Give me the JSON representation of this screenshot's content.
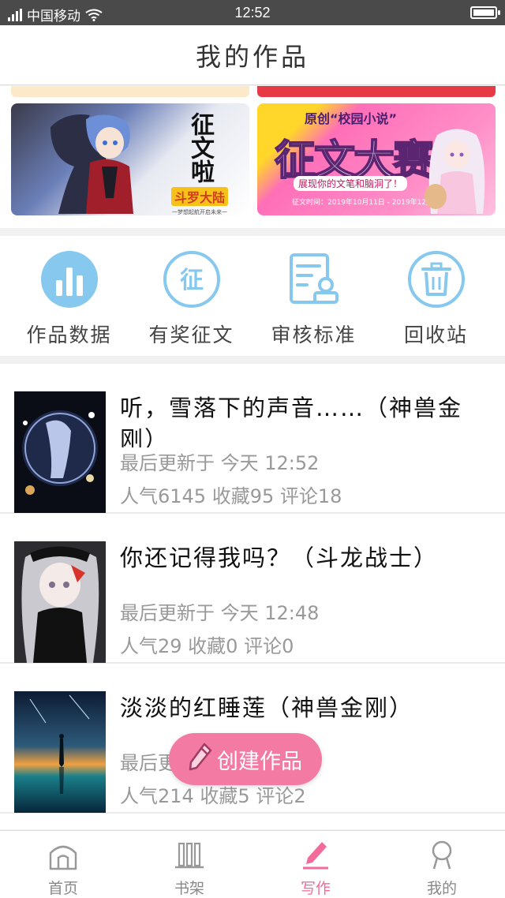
{
  "status_bar": {
    "carrier": "中国移动",
    "time": "12:52"
  },
  "header": {
    "title": "我的作品"
  },
  "banners": [
    {
      "title": "征文啦",
      "subtitle": "斗罗大陆",
      "caption": "一梦想起航开启未来一"
    },
    {
      "heading": "原创“校园小说”",
      "title": "征文大赛",
      "subtitle": "展现你的文笔和脑洞了！",
      "date": "征文时间：2019年10月11日 - 2019年12月31日"
    }
  ],
  "actions": [
    {
      "label": "作品数据",
      "icon": "bar-chart-icon"
    },
    {
      "label": "有奖征文",
      "icon": "zheng-badge-icon"
    },
    {
      "label": "审核标准",
      "icon": "document-stamp-icon"
    },
    {
      "label": "回收站",
      "icon": "trash-icon"
    }
  ],
  "works": [
    {
      "title": "听，雪落下的声音……（神兽金刚）",
      "updated": "最后更新于 今天 12:52",
      "stats": "人气6145 收藏95 评论18"
    },
    {
      "title": "你还记得我吗？（斗龙战士）",
      "updated": "最后更新于 今天 12:48",
      "stats": "人气29 收藏0 评论0"
    },
    {
      "title": "淡淡的红睡莲（神兽金刚）",
      "updated": "最后更新于 今天 12:55",
      "stats": "人气214 收藏5 评论2"
    }
  ],
  "create_button": {
    "label": "创建作品"
  },
  "bottom_nav": [
    {
      "label": "首页",
      "icon": "home-icon"
    },
    {
      "label": "书架",
      "icon": "bookshelf-icon"
    },
    {
      "label": "写作",
      "icon": "pen-icon",
      "active": true
    },
    {
      "label": "我的",
      "icon": "profile-icon"
    }
  ],
  "colors": {
    "accent_pink": "#f27aa3",
    "action_blue": "#86c8ee",
    "status_bar": "#4a4a4a"
  }
}
